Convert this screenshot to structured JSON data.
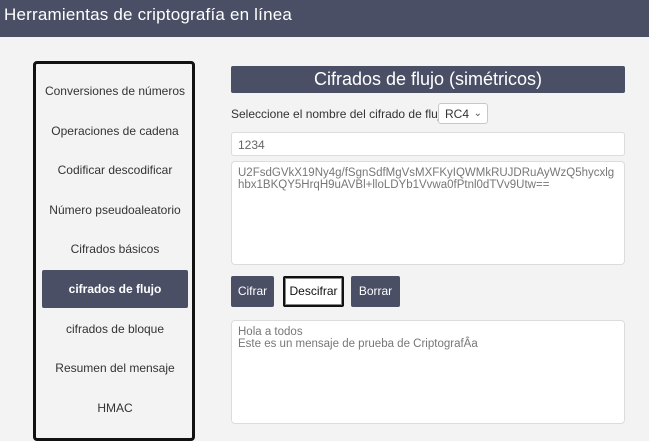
{
  "header": {
    "title": "Herramientas de criptografía en línea"
  },
  "sidebar": {
    "items": [
      {
        "label": "Conversiones de números"
      },
      {
        "label": "Operaciones de cadena"
      },
      {
        "label": "Codificar descodificar"
      },
      {
        "label": "Número pseudoaleatorio"
      },
      {
        "label": "Cifrados básicos"
      },
      {
        "label": "cifrados de flujo",
        "active": true
      },
      {
        "label": "cifrados de bloque"
      },
      {
        "label": "Resumen del mensaje"
      },
      {
        "label": "HMAC"
      }
    ]
  },
  "main": {
    "title": "Cifrados de flujo (simétricos)",
    "cipher_select": {
      "label": "Seleccione el nombre del cifrado de flujo",
      "value": "RC4"
    },
    "key_value": "1234",
    "ciphertext": "U2FsdGVkX19Ny4g/fSgnSdfMgVsMXFKyIQWMkRUJDRuAyWzQ5hycxlg\nhbx1BKQY5HrqH9uAVBl+lloLDYb1Vvwa0fPtnl0dTVv9Utw==",
    "buttons": {
      "encrypt": "Cifrar",
      "decrypt": "Descifrar",
      "clear": "Borrar"
    },
    "plaintext": "Hola a todos\nEste es un mensaje de prueba de CriptografÂa"
  },
  "colors": {
    "accent": "#4a4f66",
    "background": "#f3f3f3"
  }
}
